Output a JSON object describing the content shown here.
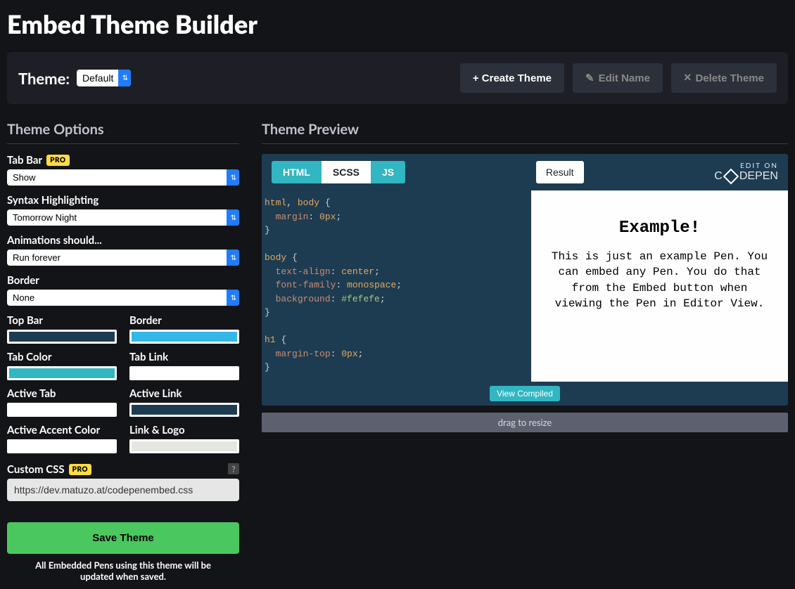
{
  "page_title": "Embed Theme Builder",
  "theme_bar": {
    "label": "Theme:",
    "selected": "Default",
    "create": "+ Create Theme",
    "edit": "Edit Name",
    "delete": "Delete Theme"
  },
  "options": {
    "title": "Theme Options",
    "tab_bar": {
      "label": "Tab Bar",
      "badge": "PRO",
      "value": "Show"
    },
    "syntax": {
      "label": "Syntax Highlighting",
      "value": "Tomorrow Night"
    },
    "animations": {
      "label": "Animations should...",
      "value": "Run forever"
    },
    "border_sel": {
      "label": "Border",
      "value": "None"
    },
    "colors": {
      "top_bar": {
        "label": "Top Bar",
        "value": "#1d3c52"
      },
      "border": {
        "label": "Border",
        "value": "#33b7e6"
      },
      "tab_color": {
        "label": "Tab Color",
        "value": "#31b6c2"
      },
      "tab_link": {
        "label": "Tab Link",
        "value": "#ffffff"
      },
      "active_tab": {
        "label": "Active Tab",
        "value": "#ffffff"
      },
      "active_link": {
        "label": "Active Link",
        "value": "#1d3c52"
      },
      "active_accent": {
        "label": "Active Accent Color",
        "value": "#ffffff"
      },
      "link_logo": {
        "label": "Link & Logo",
        "value": "#e6e6e0"
      }
    },
    "custom_css": {
      "label": "Custom CSS",
      "badge": "PRO",
      "value": "https://dev.matuzo.at/codepenembed.css"
    },
    "save": "Save Theme",
    "save_note": "All Embedded Pens using this theme will be updated when saved."
  },
  "preview": {
    "title": "Theme Preview",
    "tabs": {
      "html": "HTML",
      "scss": "SCSS",
      "js": "JS"
    },
    "result_btn": "Result",
    "edit_on": "EDIT ON",
    "logo": "CODEPEN",
    "view_compiled": "View Compiled",
    "resize": "drag to resize",
    "example_heading": "Example!",
    "example_body": "This is just an example Pen. You can embed any Pen. You do that from the Embed button when viewing the Pen in Editor View."
  }
}
